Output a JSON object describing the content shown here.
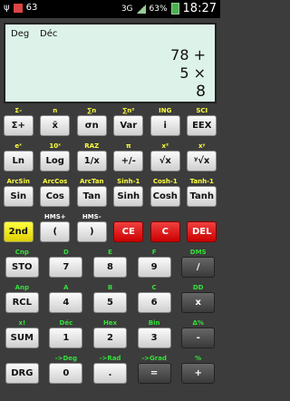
{
  "status": {
    "carrier_icon": "usb-icon",
    "notification": "63",
    "network": "3G",
    "battery": "63%",
    "time": "18:27"
  },
  "display": {
    "mode1": "Deg",
    "mode2": "Déc",
    "line1": "78 +",
    "line2": "5 ×",
    "line3": "8"
  },
  "colors": {
    "label_green": "#34e23a",
    "label_yellow": "#ffff40",
    "label_red": "#ff4040",
    "label_white": "#ffffff"
  },
  "rows": [
    {
      "keys": [
        {
          "label": "Σ+",
          "sub": "Σ-",
          "sub_color": "yellow"
        },
        {
          "label": "x̄",
          "sub": "n",
          "sub_color": "yellow"
        },
        {
          "label": "σn",
          "sub": "∑n",
          "sub_color": "yellow"
        },
        {
          "label": "Var",
          "sub": "∑n²",
          "sub_color": "yellow"
        },
        {
          "label": "i",
          "sub": "ING",
          "sub_color": "yellow"
        },
        {
          "label": "EEX",
          "sub": "SCI",
          "sub_color": "yellow"
        }
      ]
    },
    {
      "keys": [
        {
          "label": "Ln",
          "sub": "eˣ",
          "sub_color": "yellow"
        },
        {
          "label": "Log",
          "sub": "10ˣ",
          "sub_color": "yellow"
        },
        {
          "label": "1/x",
          "sub": "RAZ",
          "sub_color": "yellow"
        },
        {
          "label": "+/-",
          "sub": "π",
          "sub_color": "yellow"
        },
        {
          "label": "√x",
          "sub": "x²",
          "sub_color": "yellow"
        },
        {
          "label": "ʸ√x",
          "sub": "xʸ",
          "sub_color": "yellow"
        }
      ]
    },
    {
      "keys": [
        {
          "label": "Sin",
          "sub": "ArcSin",
          "sub_color": "yellow"
        },
        {
          "label": "Cos",
          "sub": "ArcCos",
          "sub_color": "yellow"
        },
        {
          "label": "Tan",
          "sub": "ArcTan",
          "sub_color": "yellow"
        },
        {
          "label": "Sinh",
          "sub": "Sinh-1",
          "sub_color": "yellow"
        },
        {
          "label": "Cosh",
          "sub": "Cosh-1",
          "sub_color": "yellow"
        },
        {
          "label": "Tanh",
          "sub": "Tanh-1",
          "sub_color": "yellow"
        }
      ]
    },
    {
      "keys": [
        {
          "label": "2nd",
          "sub": "",
          "sub_color": "yellow",
          "style": "yellow"
        },
        {
          "label": "(",
          "sub": "HMS+",
          "sub_color": "white"
        },
        {
          "label": ")",
          "sub": "HMS-",
          "sub_color": "white"
        },
        {
          "label": "CE",
          "sub": "",
          "sub_color": "white",
          "style": "red"
        },
        {
          "label": "C",
          "sub": "",
          "sub_color": "white",
          "style": "red"
        },
        {
          "label": "DEL",
          "sub": "",
          "sub_color": "white",
          "style": "red"
        }
      ]
    },
    {
      "keys": [
        {
          "label": "STO",
          "sub": "Cnp",
          "sub_color": "green"
        },
        {
          "label": "7",
          "sub": "D",
          "sub_color": "green"
        },
        {
          "label": "8",
          "sub": "E",
          "sub_color": "green"
        },
        {
          "label": "9",
          "sub": "F",
          "sub_color": "green"
        },
        {
          "label": "/",
          "sub": "DMS",
          "sub_color": "green",
          "style": "dark"
        }
      ]
    },
    {
      "keys": [
        {
          "label": "RCL",
          "sub": "Anp",
          "sub_color": "green"
        },
        {
          "label": "4",
          "sub": "A",
          "sub_color": "green"
        },
        {
          "label": "5",
          "sub": "B",
          "sub_color": "green"
        },
        {
          "label": "6",
          "sub": "C",
          "sub_color": "green"
        },
        {
          "label": "x",
          "sub": "DD",
          "sub_color": "green",
          "style": "dark"
        }
      ]
    },
    {
      "keys": [
        {
          "label": "SUM",
          "sub": "x!",
          "sub_color": "green"
        },
        {
          "label": "1",
          "sub": "Déc",
          "sub_color": "green"
        },
        {
          "label": "2",
          "sub": "Hex",
          "sub_color": "green"
        },
        {
          "label": "3",
          "sub": "Bin",
          "sub_color": "green"
        },
        {
          "label": "-",
          "sub": "Δ%",
          "sub_color": "green",
          "style": "dark"
        }
      ]
    },
    {
      "keys": [
        {
          "label": "DRG",
          "sub": "",
          "sub_color": "green"
        },
        {
          "label": "0",
          "sub": "->Deg",
          "sub_color": "green"
        },
        {
          "label": ".",
          "sub": "->Rad",
          "sub_color": "green"
        },
        {
          "label": "=",
          "sub": "->Grad",
          "sub_color": "green",
          "style": "dark"
        },
        {
          "label": "+",
          "sub": "%",
          "sub_color": "green",
          "style": "dark"
        }
      ]
    }
  ]
}
